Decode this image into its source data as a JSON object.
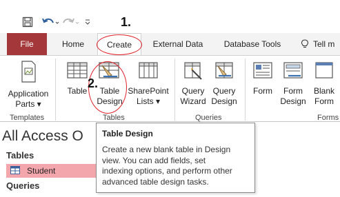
{
  "annotations": {
    "step1": "1.",
    "step2": "2."
  },
  "tabs": [
    "File",
    "Home",
    "Create",
    "External Data",
    "Database Tools",
    "Tell m"
  ],
  "ribbon": {
    "application_parts": [
      "Application",
      "Parts ▾"
    ],
    "table": "Table",
    "table_design": [
      "Table",
      "Design"
    ],
    "sharepoint_lists": [
      "SharePoint",
      "Lists ▾"
    ],
    "query_wizard": [
      "Query",
      "Wizard"
    ],
    "query_design": [
      "Query",
      "Design"
    ],
    "form": "Form",
    "form_design": [
      "Form",
      "Design"
    ],
    "blank_form": [
      "Blank",
      "Form"
    ],
    "groups": {
      "templates": "Templates",
      "tables": "Tables",
      "queries": "Queries",
      "forms": "Forms"
    }
  },
  "nav": {
    "title": "All Access O",
    "tables_header": "Tables",
    "student": "Student",
    "queries_header": "Queries"
  },
  "tooltip": {
    "title": "Table Design",
    "lines": [
      "Create a new blank table in Design",
      "view. You can add fields, set",
      "indexing options, and perform other",
      "advanced table design tasks."
    ]
  },
  "colors": {
    "file_tab": "#a4373a",
    "annotation": "#e0202a",
    "nav_selected": "#f3a6ac"
  }
}
